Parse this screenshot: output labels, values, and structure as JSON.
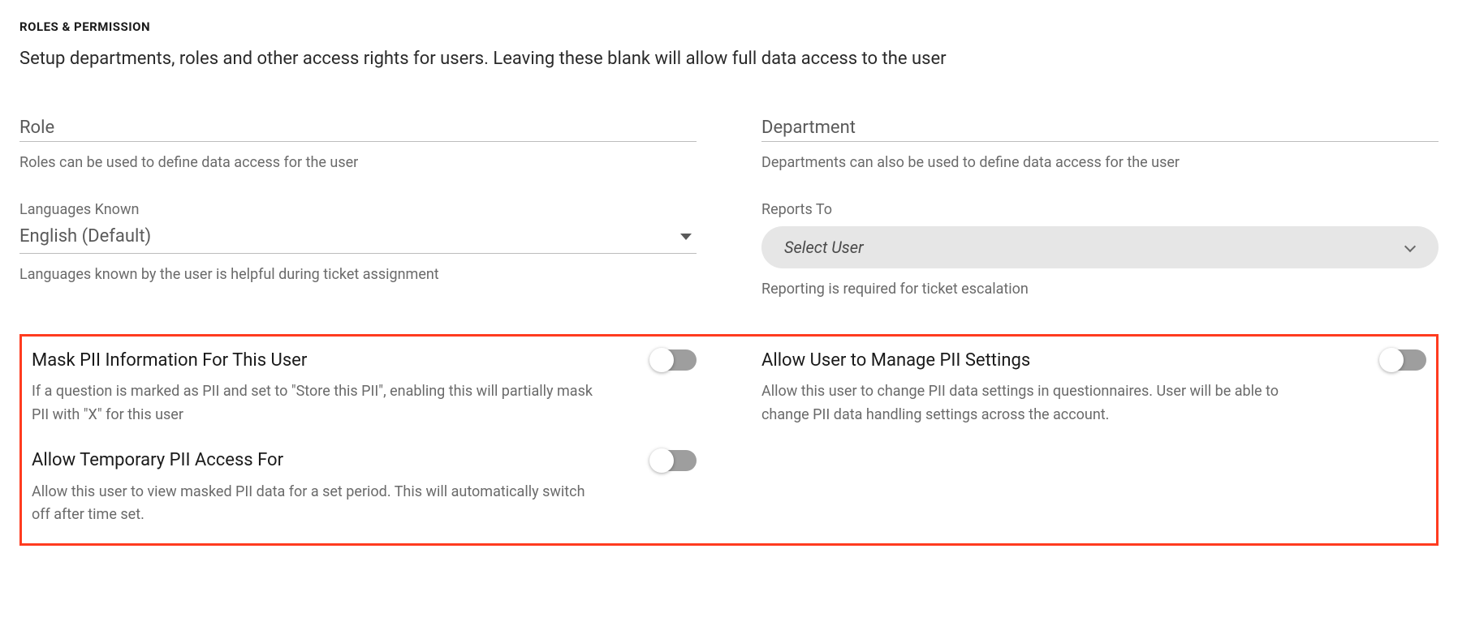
{
  "header": {
    "title": "ROLES & PERMISSION",
    "description": "Setup departments, roles and other access rights for users. Leaving these blank will allow full data access to the user"
  },
  "left": {
    "role": {
      "label": "Role",
      "help": "Roles can be used to define data access for the user"
    },
    "languages": {
      "label": "Languages Known",
      "value": "English (Default)",
      "help": "Languages known by the user is helpful during ticket assignment"
    }
  },
  "right": {
    "department": {
      "label": "Department",
      "help": "Departments can also be used to define data access for the user"
    },
    "reportsTo": {
      "label": "Reports To",
      "placeholder": "Select User",
      "help": "Reporting is required for ticket escalation"
    }
  },
  "pii": {
    "maskPii": {
      "title": "Mask PII Information For This User",
      "help": "If a question is marked as PII and set to \"Store this PII\", enabling this will partially mask PII with \"X\" for this user"
    },
    "tempAccess": {
      "title": "Allow Temporary PII Access For",
      "help": "Allow this user to view masked PII data for a set period. This will automatically switch off after time set."
    },
    "manageSettings": {
      "title": "Allow User to Manage PII Settings",
      "help": "Allow this user to change PII data settings in questionnaires. User will be able to change PII data handling settings across the account."
    }
  }
}
